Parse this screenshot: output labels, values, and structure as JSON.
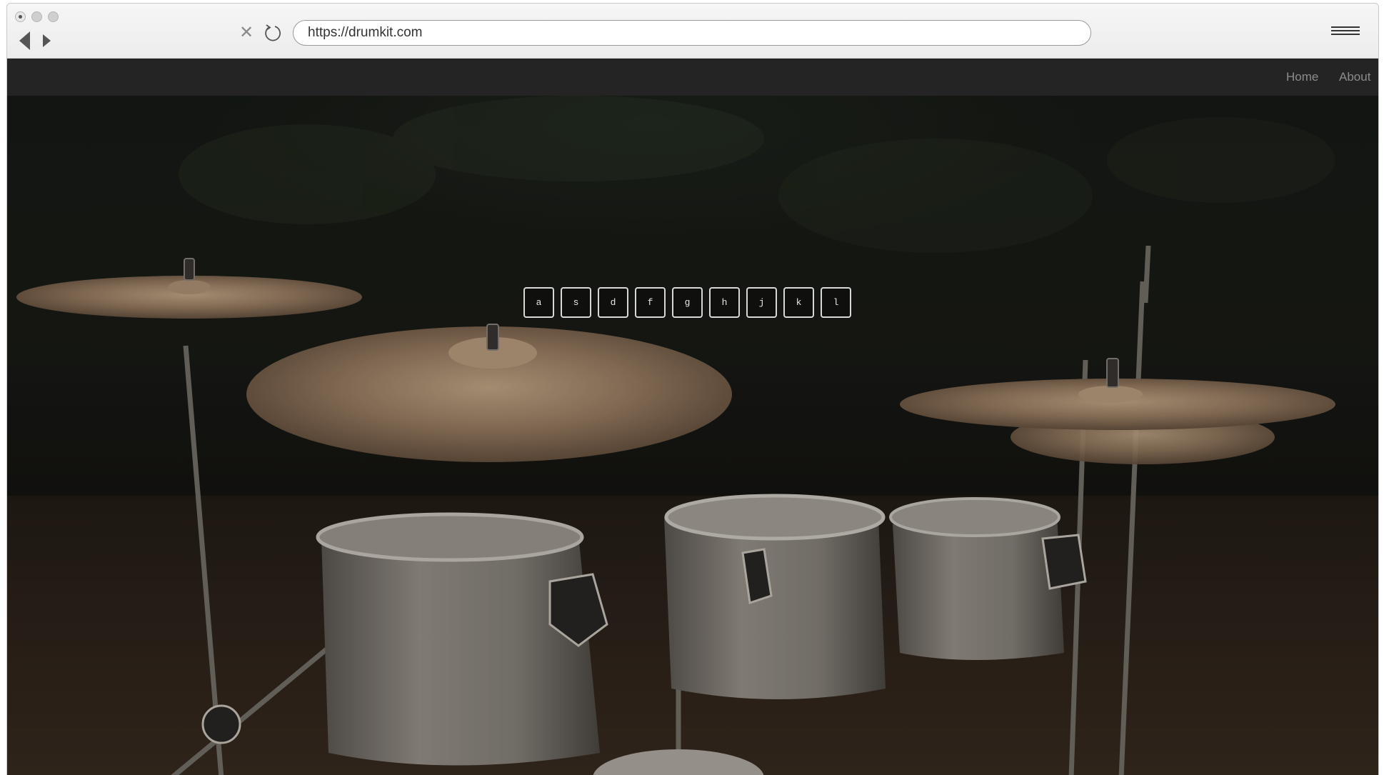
{
  "browser": {
    "url": "https://drumkit.com",
    "stop_glyph": "✕"
  },
  "nav": {
    "home_label": "Home",
    "about_label": "About"
  },
  "keys": [
    "a",
    "s",
    "d",
    "f",
    "g",
    "h",
    "j",
    "k",
    "l"
  ],
  "icons": {
    "back": "back-arrow-icon",
    "forward": "forward-arrow-icon",
    "stop": "close-icon",
    "reload": "reload-icon",
    "menu": "hamburger-menu-icon"
  },
  "colors": {
    "nav_background": "#242424",
    "nav_link": "#8c8c8c",
    "key_border": "#d8d8d8"
  }
}
